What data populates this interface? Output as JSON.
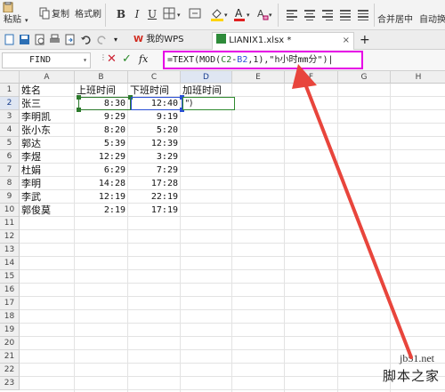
{
  "ribbon": {
    "paste_label": "粘贴",
    "copy_label": "复制",
    "format_painter_label": "格式刷",
    "bold": "B",
    "italic": "I",
    "underline": "U",
    "merge_label": "合并居中",
    "wrap_label": "自动换行"
  },
  "tabs": {
    "wps_label": "我的WPS",
    "file_label": "LIANIX1.xlsx *",
    "close_glyph": "×",
    "new_tab_glyph": "+"
  },
  "formula_bar": {
    "name_box": "FIND",
    "formula_prefix": "=TEXT(MOD(",
    "ref1": "C2",
    "minus": "-",
    "ref2": "B2",
    "formula_suffix": ",1),\"h小时mm分\")|",
    "cancel_glyph": "✕",
    "confirm_glyph": "✓",
    "fx_label": "fx"
  },
  "columns": [
    "A",
    "B",
    "C",
    "D",
    "E",
    "F",
    "G",
    "H"
  ],
  "rows": [
    "1",
    "2",
    "3",
    "4",
    "5",
    "6",
    "7",
    "8",
    "9",
    "10",
    "11",
    "12",
    "13",
    "14",
    "15",
    "16",
    "17",
    "18",
    "19",
    "20",
    "21",
    "22",
    "23"
  ],
  "sheet": {
    "headers": [
      "姓名",
      "上班时间",
      "下班时间",
      "加班时间"
    ],
    "records": [
      {
        "name": "张三",
        "start": "8:30",
        "end": "12:40"
      },
      {
        "name": "李明凯",
        "start": "9:29",
        "end": "9:19"
      },
      {
        "name": "张小东",
        "start": "8:20",
        "end": "5:20"
      },
      {
        "name": "郭达",
        "start": "5:39",
        "end": "12:39"
      },
      {
        "name": "李煜",
        "start": "12:29",
        "end": "3:29"
      },
      {
        "name": "杜娟",
        "start": "6:29",
        "end": "7:29"
      },
      {
        "name": "李明",
        "start": "14:28",
        "end": "17:28"
      },
      {
        "name": "李武",
        "start": "12:19",
        "end": "22:19"
      },
      {
        "name": "郭俊莫",
        "start": "2:19",
        "end": "17:19"
      }
    ],
    "editing_text": "\")"
  },
  "watermark": {
    "domain": "jb51.net",
    "site": "脚本之家"
  },
  "colors": {
    "formula_border": "#e600e6",
    "arrow": "#e8453c",
    "ref_green": "#2c7a2c",
    "ref_blue": "#2a4fd6"
  }
}
